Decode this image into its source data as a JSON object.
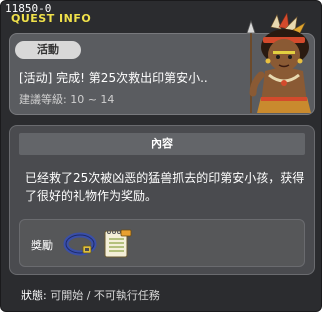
{
  "window": {
    "quest_id": "11850-0",
    "title": "QUEST INFO"
  },
  "quest": {
    "category": "活動",
    "name": "[活动] 完成! 第25次救出印第安小..",
    "level_label": "建議等級",
    "level_sep": ":",
    "level_range": "10 ~ 14"
  },
  "content": {
    "header": "內容",
    "text": "已经救了25次被凶恶的猛兽抓去的印第安小孩，获得了很好的礼物作为奖励。",
    "reward_label": "獎勵",
    "rewards": [
      {
        "name": "belt",
        "icon": "belt-icon"
      },
      {
        "name": "notepad",
        "icon": "notepad-icon"
      }
    ]
  },
  "status": {
    "label": "狀態",
    "sep": ":",
    "value": "可開始 / 不可執行任務"
  },
  "colors": {
    "title": "#f0e14a",
    "window_bg": "#2b2c2f",
    "card_bg": "#5a5c60"
  }
}
